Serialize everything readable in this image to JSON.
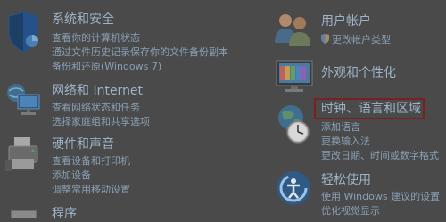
{
  "colors": {
    "background": "#4a4a4a",
    "title": "#9fb3c8",
    "link": "#8aa0b6",
    "highlight_border": "#7a2020"
  },
  "left_column": [
    {
      "title": "系统和安全",
      "icon": "shield-icon",
      "links": [
        "查看你的计算机状态",
        "通过文件历史记录保存你的文件备份副本",
        "备份和还原(Windows 7)"
      ]
    },
    {
      "title": "网络和 Internet",
      "icon": "network-icon",
      "links": [
        "查看网络状态和任务",
        "选择家庭组和共享选项"
      ]
    },
    {
      "title": "硬件和声音",
      "icon": "printer-icon",
      "links": [
        "查看设备和打印机",
        "添加设备",
        "调整常用移动设置"
      ]
    },
    {
      "title": "程序",
      "icon": "programs-icon",
      "links": []
    }
  ],
  "right_column": [
    {
      "title": "用户帐户",
      "icon": "users-icon",
      "links": [
        "更改帐户类型"
      ]
    },
    {
      "title": "外观和个性化",
      "icon": "display-icon",
      "links": []
    },
    {
      "title": "时钟、语言和区域",
      "icon": "clock-globe-icon",
      "links": [
        "添加语言",
        "更换输入法",
        "更改日期、时间或数字格式"
      ]
    },
    {
      "title": "轻松使用",
      "icon": "accessibility-icon",
      "links": [
        "使用 Windows 建议的设置",
        "优化视觉显示"
      ]
    }
  ]
}
